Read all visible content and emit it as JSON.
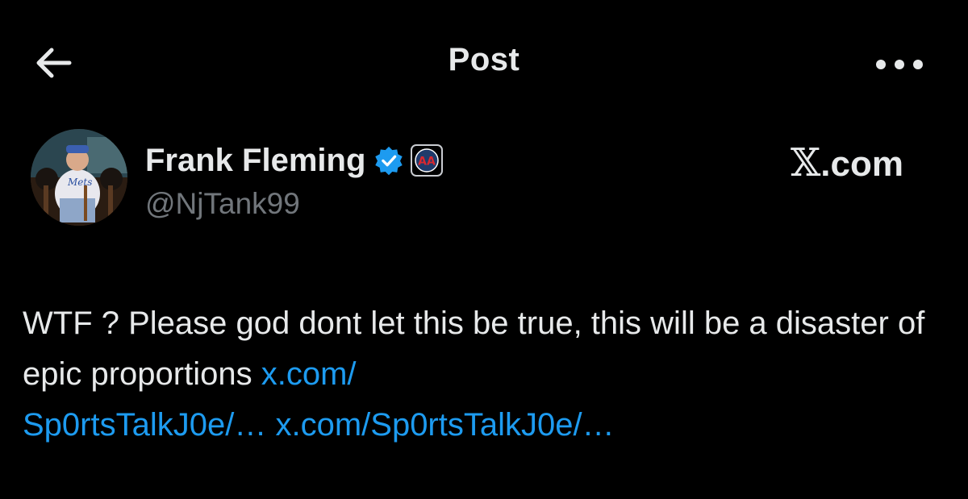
{
  "header": {
    "title": "Post",
    "back_icon": "arrow-left-icon",
    "more_icon": "ellipsis-icon"
  },
  "author": {
    "display_name": "Frank Fleming",
    "handle": "@NjTank99",
    "verified_icon": "verified-badge-icon",
    "affiliation_icon": "barstool-sports-badge-icon"
  },
  "watermark": {
    "logo": "𝕏",
    "text": ".com"
  },
  "post": {
    "text": "WTF ? Please god dont let this be true, this will be a disaster of epic proportions",
    "link_1": "x.com/\nSp0rtsTalkJ0e/…",
    "link_1_line_a": "x.com/",
    "link_1_line_b": "Sp0rtsTalkJ0e/…",
    "link_2": "x.com/Sp0rtsTalkJ0e/…"
  },
  "colors": {
    "background": "#000000",
    "primary_text": "#e7e9ea",
    "secondary_text": "#71767b",
    "link": "#1d9bf0",
    "verified": "#1d9bf0"
  }
}
